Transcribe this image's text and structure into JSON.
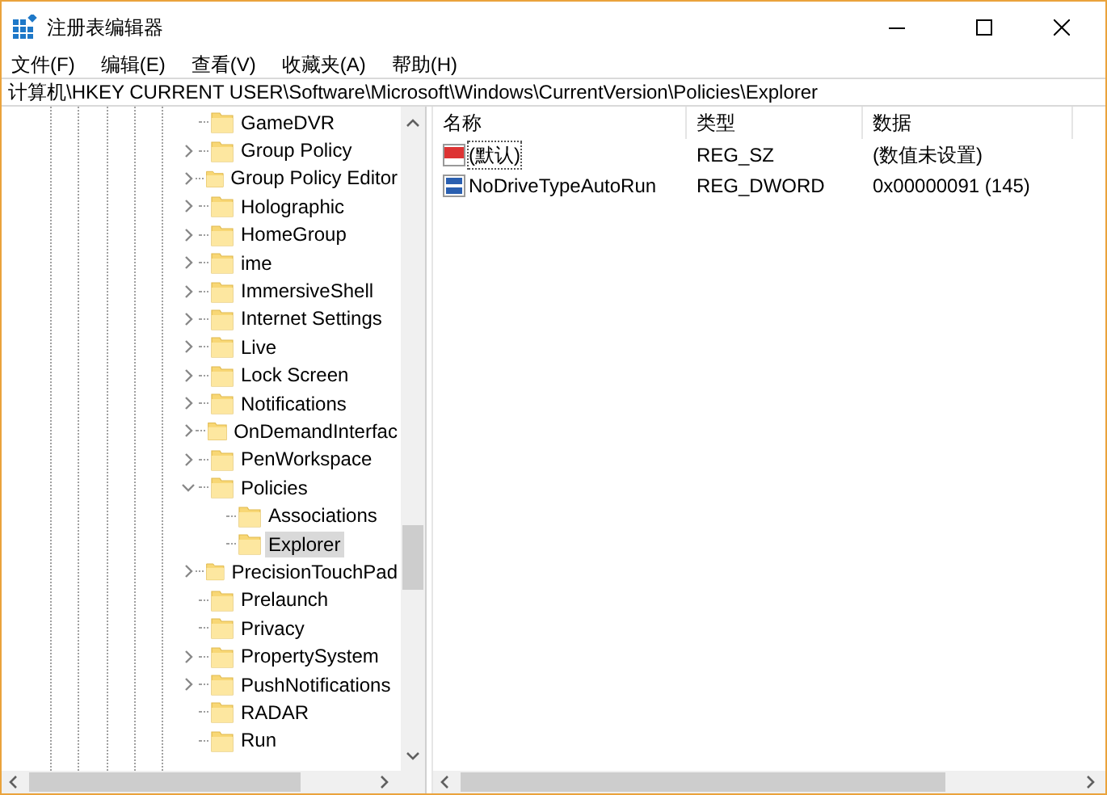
{
  "window": {
    "title": "注册表编辑器"
  },
  "menu": [
    "文件(F)",
    "编辑(E)",
    "查看(V)",
    "收藏夹(A)",
    "帮助(H)"
  ],
  "address": "计算机\\HKEY CURRENT USER\\Software\\Microsoft\\Windows\\CurrentVersion\\Policies\\Explorer",
  "tree": [
    {
      "label": "GameDVR",
      "selected": false
    },
    {
      "label": "Group Policy",
      "expanded": false,
      "selected": false
    },
    {
      "label": "Group Policy Editor",
      "expanded": false,
      "selected": false
    },
    {
      "label": "Holographic",
      "expanded": false,
      "selected": false
    },
    {
      "label": "HomeGroup",
      "expanded": false,
      "selected": false
    },
    {
      "label": "ime",
      "expanded": false,
      "selected": false
    },
    {
      "label": "ImmersiveShell",
      "expanded": false,
      "selected": false
    },
    {
      "label": "Internet Settings",
      "expanded": false,
      "selected": false
    },
    {
      "label": "Live",
      "expanded": false,
      "selected": false
    },
    {
      "label": "Lock Screen",
      "expanded": false,
      "selected": false
    },
    {
      "label": "Notifications",
      "expanded": false,
      "selected": false
    },
    {
      "label": "OnDemandInterfac",
      "expanded": false,
      "selected": false
    },
    {
      "label": "PenWorkspace",
      "expanded": false,
      "selected": false
    },
    {
      "label": "Policies",
      "expanded": true,
      "selected": false,
      "children": [
        {
          "label": "Associations",
          "selected": false
        },
        {
          "label": "Explorer",
          "selected": true
        }
      ]
    },
    {
      "label": "PrecisionTouchPad",
      "expanded": false,
      "selected": false
    },
    {
      "label": "Prelaunch",
      "selected": false
    },
    {
      "label": "Privacy",
      "selected": false
    },
    {
      "label": "PropertySystem",
      "expanded": false,
      "selected": false
    },
    {
      "label": "PushNotifications",
      "expanded": false,
      "selected": false
    },
    {
      "label": "RADAR",
      "selected": false
    },
    {
      "label": "Run",
      "selected": false
    }
  ],
  "table": {
    "columns": [
      "名称",
      "类型",
      "数据"
    ],
    "rows": [
      {
        "kind": "string",
        "name": "(默认)",
        "type": "REG_SZ",
        "data": "(数值未设置)",
        "focused": true
      },
      {
        "kind": "binary",
        "name": "NoDriveTypeAutoRun",
        "type": "REG_DWORD",
        "data": "0x00000091 (145)",
        "focused": false
      }
    ]
  }
}
